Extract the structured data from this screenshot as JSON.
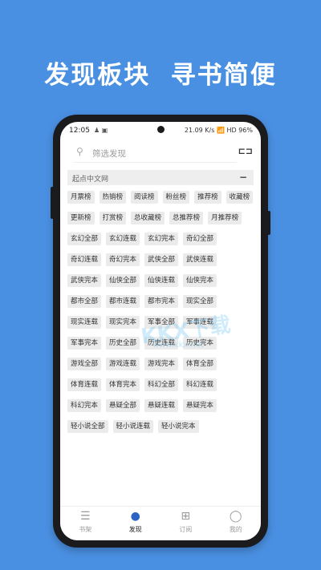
{
  "headline": "发现板块  寻书简便",
  "status": {
    "time": "12:05",
    "battery": "96%",
    "net": "21.09 K/s",
    "signal": "HD"
  },
  "search": {
    "placeholder": "筛选发现"
  },
  "section": {
    "title": "起点中文网",
    "collapse": "−"
  },
  "tags": [
    "月票榜",
    "热销榜",
    "阅读榜",
    "粉丝榜",
    "推荐榜",
    "收藏榜",
    "更新榜",
    "打赏榜",
    "总收藏榜",
    "总推荐榜",
    "月推荐榜",
    "玄幻全部",
    "玄幻连载",
    "玄幻完本",
    "奇幻全部",
    "奇幻连载",
    "奇幻完本",
    "武侠全部",
    "武侠连载",
    "武侠完本",
    "仙侠全部",
    "仙侠连载",
    "仙侠完本",
    "都市全部",
    "都市连载",
    "都市完本",
    "现实全部",
    "现实连载",
    "现实完本",
    "军事全部",
    "军事连载",
    "军事完本",
    "历史全部",
    "历史连载",
    "历史完本",
    "游戏全部",
    "游戏连载",
    "游戏完本",
    "体育全部",
    "体育连载",
    "体育完本",
    "科幻全部",
    "科幻连载",
    "科幻完本",
    "悬疑全部",
    "悬疑连载",
    "悬疑完本",
    "轻小说全部",
    "轻小说连载",
    "轻小说完本"
  ],
  "watermark": {
    "main": "KKX下载",
    "sub": "www.kkx.net"
  },
  "tabs": [
    {
      "label": "书架",
      "icon": "bookshelf-icon",
      "glyph": "☰"
    },
    {
      "label": "发现",
      "icon": "compass-icon",
      "glyph": "●"
    },
    {
      "label": "订阅",
      "icon": "subscribe-icon",
      "glyph": "⊞"
    },
    {
      "label": "我的",
      "icon": "user-icon",
      "glyph": "◯"
    }
  ],
  "colors": {
    "accent": "#2b63c4",
    "background": "#4a90e2"
  }
}
